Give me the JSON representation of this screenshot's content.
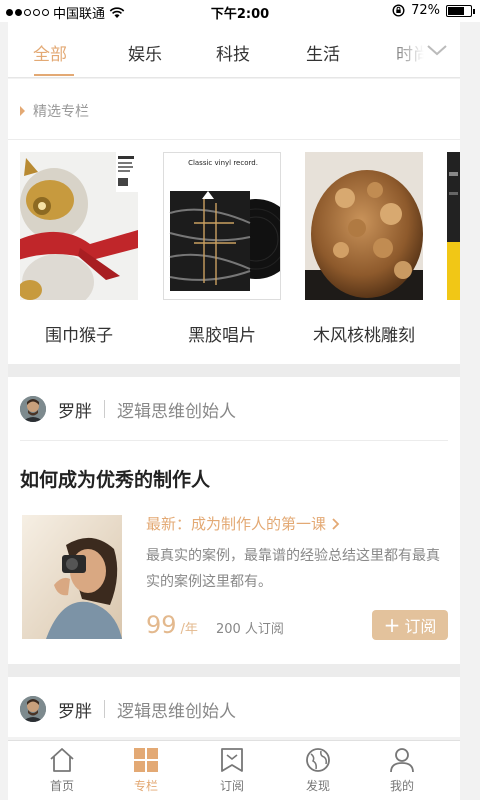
{
  "status_bar": {
    "carrier": "中国联通",
    "time": "下午2:00",
    "battery": "72%",
    "battery_level": 0.72
  },
  "tabs": [
    "全部",
    "娱乐",
    "科技",
    "生活",
    "时尚"
  ],
  "active_tab": 0,
  "featured": {
    "section_title": "精选专栏",
    "items": [
      {
        "label": "围巾猴子"
      },
      {
        "label": "黑胶唱片",
        "cover_text": "Classic vinyl record."
      },
      {
        "label": "木风核桃雕刻"
      }
    ]
  },
  "post": {
    "author_name": "罗胖",
    "author_title": "逻辑思维创始人",
    "title": "如何成为优秀的制作人",
    "latest": "最新：成为制作人的第一课",
    "description": "最真实的案例，最靠谱的经验总结这里都有最真实的案例这里都有。",
    "price": "99",
    "price_unit": "/年",
    "subscribers": "200 人订阅",
    "subscribe_label": "订阅"
  },
  "post2": {
    "author_name": "罗胖",
    "author_title": "逻辑思维创始人"
  },
  "bottom_nav": [
    {
      "label": "首页",
      "icon": "home-icon"
    },
    {
      "label": "专栏",
      "icon": "column-grid-icon"
    },
    {
      "label": "订阅",
      "icon": "bookmark-icon"
    },
    {
      "label": "发现",
      "icon": "globe-icon"
    },
    {
      "label": "我的",
      "icon": "profile-icon"
    }
  ],
  "colors": {
    "accent": "#e3a974",
    "button": "#e3c29c",
    "price": "#e3b98e"
  }
}
